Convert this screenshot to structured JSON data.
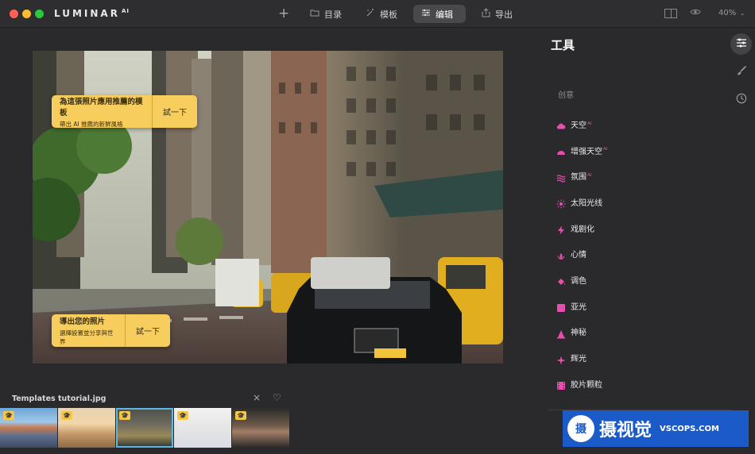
{
  "app": {
    "brand": "LUMINAR",
    "brand_sup": "AI"
  },
  "toolbar": {
    "add_label": "+",
    "catalog_label": "目录",
    "templates_label": "模板",
    "edit_label": "编辑",
    "export_label": "导出",
    "zoom_label": "40%",
    "icons": [
      "plus-icon",
      "folder-icon",
      "magic-wand-icon",
      "sliders-icon",
      "share-icon",
      "compare-icon",
      "eye-icon",
      "chevron-down-icon"
    ]
  },
  "tips": {
    "template": {
      "title": "為這張照片應用推薦的模板",
      "subtitle": "帶出 AI 推薦的新鮮風格",
      "button": "試一下"
    },
    "export": {
      "title": "導出您的照片",
      "subtitle": "選擇設置並分享與世界",
      "button": "試一下"
    }
  },
  "filmstrip": {
    "filename": "Templates tutorial.jpg",
    "close_icon": "×",
    "heart_icon": "♡",
    "thumbnails": [
      {
        "name": "harbor-houses",
        "badge": "🎓",
        "selected": false
      },
      {
        "name": "beach-sunset",
        "badge": "🎓",
        "selected": false
      },
      {
        "name": "city-street",
        "badge": "🎓",
        "selected": true
      },
      {
        "name": "woman-white",
        "badge": "🎓",
        "selected": false
      },
      {
        "name": "portrait-woman",
        "badge": "🎓",
        "selected": false
      }
    ]
  },
  "panel": {
    "title": "工具",
    "section": "创意",
    "tools": [
      {
        "label": "天空",
        "sup": "AI",
        "icon": "cloud-icon",
        "color": "#e64fb0"
      },
      {
        "label": "增强天空",
        "sup": "AI",
        "icon": "half-dome-icon",
        "color": "#e64fb0"
      },
      {
        "label": "氛围",
        "sup": "AI",
        "icon": "waves-icon",
        "color": "#e64fb0"
      },
      {
        "label": "太阳光线",
        "sup": "",
        "icon": "sun-icon",
        "color": "#e64fb0"
      },
      {
        "label": "戏剧化",
        "sup": "",
        "icon": "lightning-icon",
        "color": "#e64fb0"
      },
      {
        "label": "心情",
        "sup": "",
        "icon": "lotus-icon",
        "color": "#e64fb0"
      },
      {
        "label": "调色",
        "sup": "",
        "icon": "paint-bucket-icon",
        "color": "#e64fb0"
      },
      {
        "label": "亚光",
        "sup": "",
        "icon": "square-icon",
        "color": "#e64fb0"
      },
      {
        "label": "神秘",
        "sup": "",
        "icon": "cone-icon",
        "color": "#e64fb0"
      },
      {
        "label": "辉光",
        "sup": "",
        "icon": "sparkle-icon",
        "color": "#e64fb0"
      },
      {
        "label": "胶片颗粒",
        "sup": "",
        "icon": "film-icon",
        "color": "#e64fb0"
      }
    ],
    "side_icons": [
      "sliders-icon",
      "brush-icon",
      "history-icon"
    ]
  },
  "watermark": {
    "logo": "摄",
    "text": "摄视觉",
    "url": "VSCOPS.COM"
  },
  "colors": {
    "accent": "#e64fb0",
    "tip_bg": "#f7cd5d",
    "selected_outline": "#58b8e6"
  }
}
